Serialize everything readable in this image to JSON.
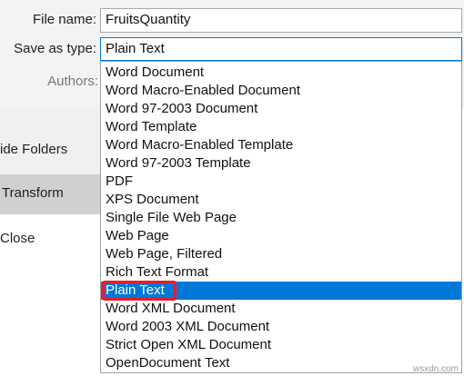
{
  "form": {
    "file_name_label": "File name:",
    "file_name_value": "FruitsQuantity",
    "save_type_label": "Save as type:",
    "save_type_value": "Plain Text",
    "authors_label": "Authors:"
  },
  "sidebar": {
    "hide_folders": "ide Folders",
    "transform": "Transform",
    "close": "Close"
  },
  "dropdown": {
    "items": [
      "Word Document",
      "Word Macro-Enabled Document",
      "Word 97-2003 Document",
      "Word Template",
      "Word Macro-Enabled Template",
      "Word 97-2003 Template",
      "PDF",
      "XPS Document",
      "Single File Web Page",
      "Web Page",
      "Web Page, Filtered",
      "Rich Text Format",
      "Plain Text",
      "Word XML Document",
      "Word 2003 XML Document",
      "Strict Open XML Document",
      "OpenDocument Text"
    ],
    "selected_index": 12
  },
  "colors": {
    "selection": "#0078d7",
    "highlight": "#e81c2c"
  },
  "watermark": "wsxdn.com"
}
